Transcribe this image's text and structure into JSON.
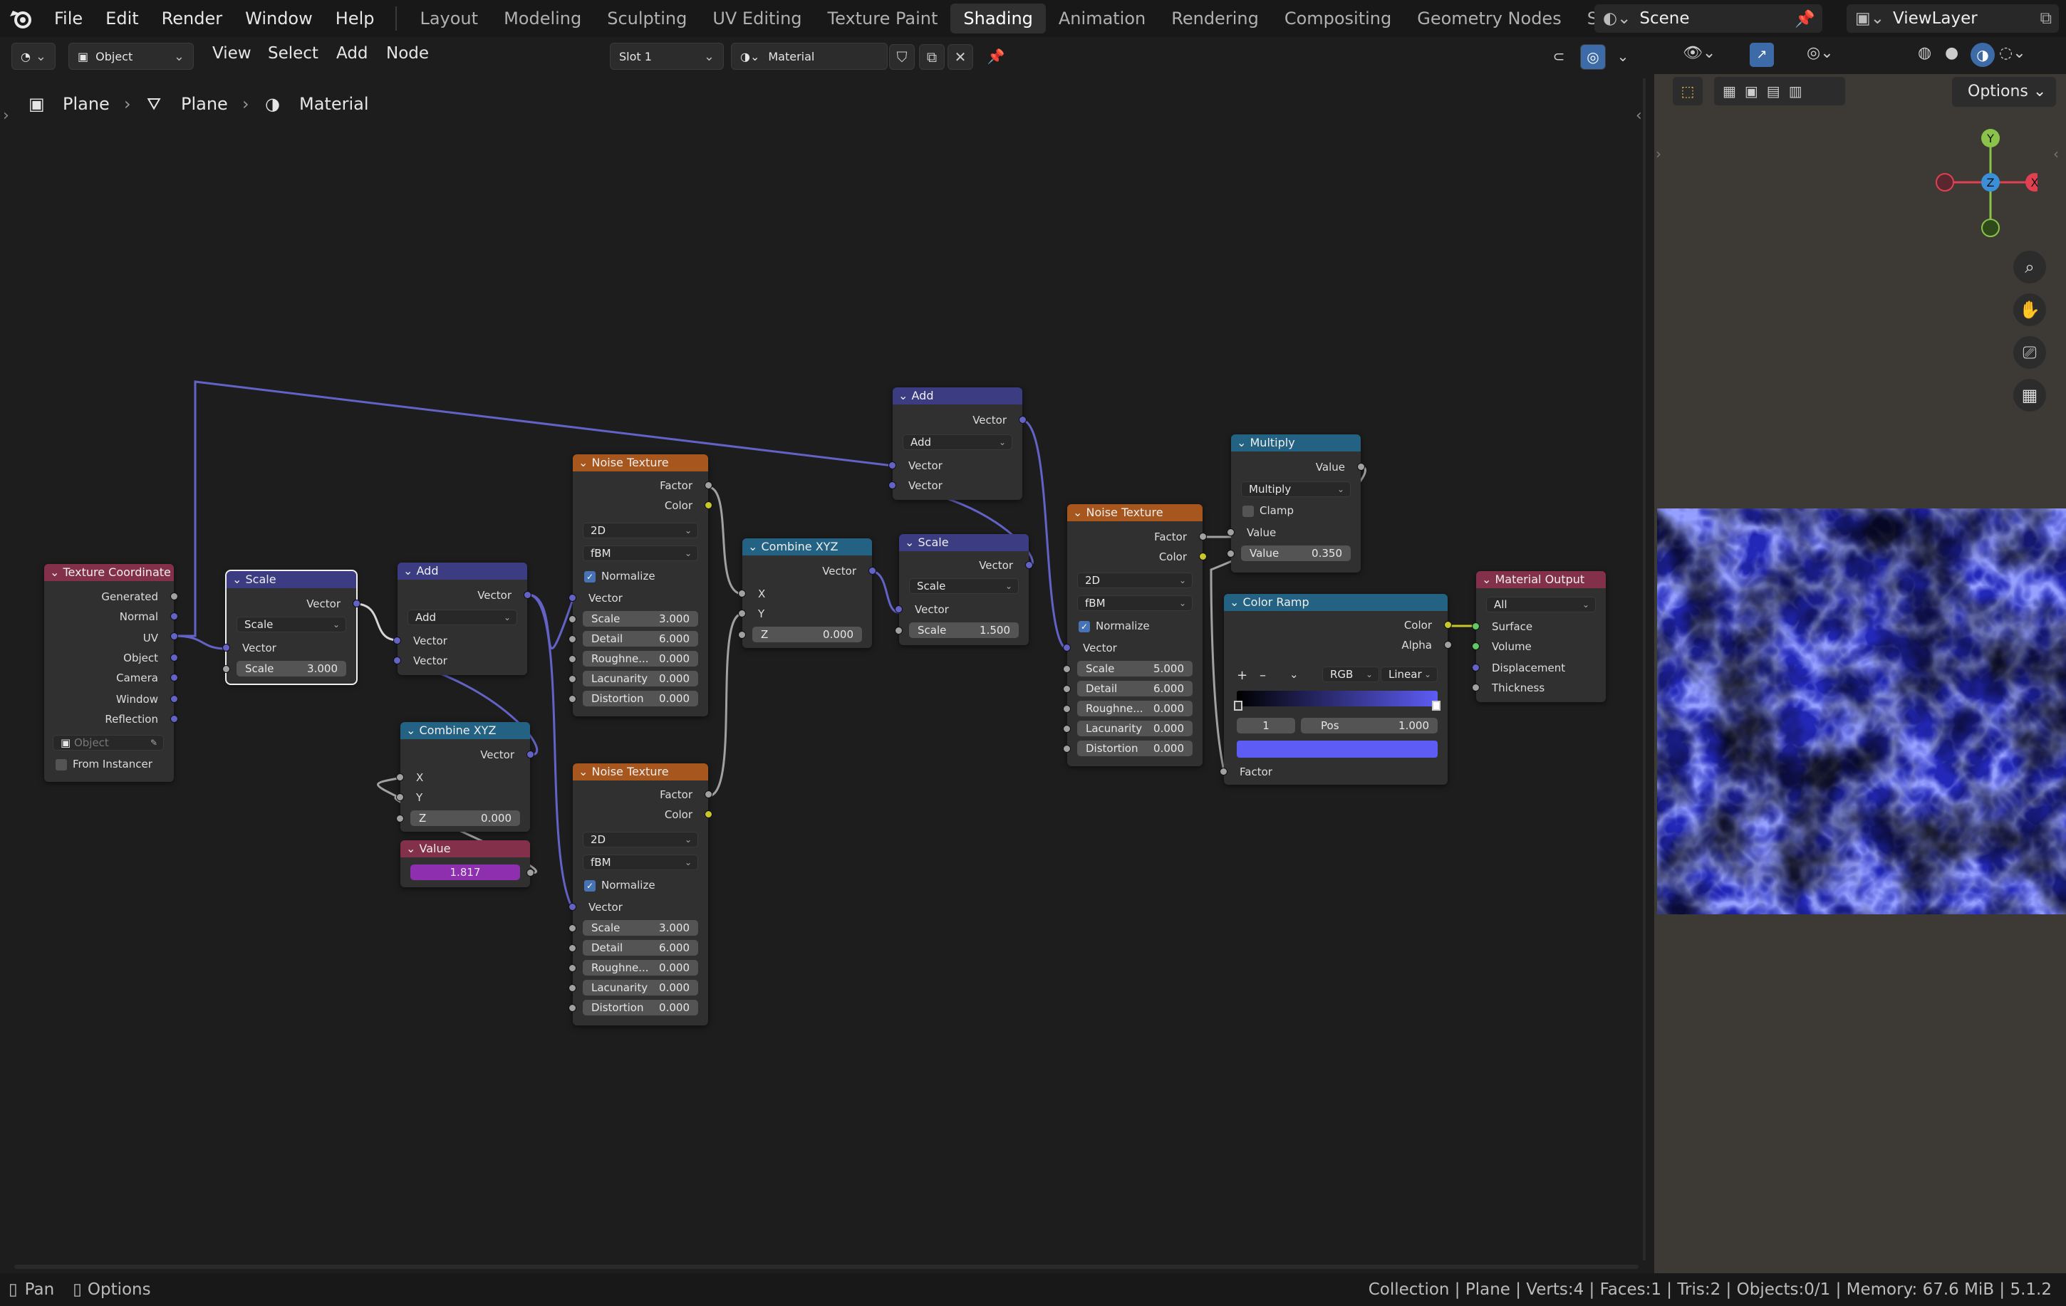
{
  "topbar": {
    "menus": [
      "File",
      "Edit",
      "Render",
      "Window",
      "Help"
    ],
    "workspaces": [
      "Layout",
      "Modeling",
      "Sculpting",
      "UV Editing",
      "Texture Paint",
      "Shading",
      "Animation",
      "Rendering",
      "Compositing",
      "Geometry Nodes",
      "Scripting"
    ],
    "active_workspace": "Shading",
    "scene": "Scene",
    "view_layer": "ViewLayer"
  },
  "editor_header": {
    "mode": "Object",
    "menus": [
      "View",
      "Select",
      "Add",
      "Node"
    ],
    "slot": "Slot 1",
    "material": "Material"
  },
  "breadcrumb": [
    "Plane",
    "Plane",
    "Material"
  ],
  "viewport": {
    "options": "Options",
    "axes": {
      "x": "X",
      "y": "Y",
      "z": "Z"
    }
  },
  "nodes": {
    "texcoord": {
      "title": "Texture Coordinate",
      "outputs": [
        "Generated",
        "Normal",
        "UV",
        "Object",
        "Camera",
        "Window",
        "Reflection"
      ],
      "object_placeholder": "Object",
      "from_instancer": "From Instancer"
    },
    "scale1": {
      "title": "Scale",
      "out": "Vector",
      "op": "Scale",
      "in": "Vector",
      "field_label": "Scale",
      "field_value": "3.000"
    },
    "add1": {
      "title": "Add",
      "out": "Vector",
      "op": "Add",
      "in1": "Vector",
      "in2": "Vector"
    },
    "combine1": {
      "title": "Combine XYZ",
      "out": "Vector",
      "x": "X",
      "y": "Y",
      "z_label": "Z",
      "z_value": "0.000"
    },
    "value": {
      "title": "Value",
      "value": "1.817"
    },
    "noise1": {
      "title": "Noise Texture",
      "out1": "Factor",
      "out2": "Color",
      "dim": "2D",
      "type": "fBM",
      "normalize": "Normalize",
      "vector": "Vector",
      "fields": [
        [
          "Scale",
          "3.000"
        ],
        [
          "Detail",
          "6.000"
        ],
        [
          "Roughne...",
          "0.000"
        ],
        [
          "Lacunarity",
          "0.000"
        ],
        [
          "Distortion",
          "0.000"
        ]
      ]
    },
    "noise2": {
      "title": "Noise Texture",
      "out1": "Factor",
      "out2": "Color",
      "dim": "2D",
      "type": "fBM",
      "normalize": "Normalize",
      "vector": "Vector",
      "fields": [
        [
          "Scale",
          "3.000"
        ],
        [
          "Detail",
          "6.000"
        ],
        [
          "Roughne...",
          "0.000"
        ],
        [
          "Lacunarity",
          "0.000"
        ],
        [
          "Distortion",
          "0.000"
        ]
      ]
    },
    "combine2": {
      "title": "Combine XYZ",
      "out": "Vector",
      "x": "X",
      "y": "Y",
      "z_label": "Z",
      "z_value": "0.000"
    },
    "add2": {
      "title": "Add",
      "out": "Vector",
      "op": "Add",
      "in1": "Vector",
      "in2": "Vector"
    },
    "scale2": {
      "title": "Scale",
      "out": "Vector",
      "op": "Scale",
      "in": "Vector",
      "field_label": "Scale",
      "field_value": "1.500"
    },
    "noise3": {
      "title": "Noise Texture",
      "out1": "Factor",
      "out2": "Color",
      "dim": "2D",
      "type": "fBM",
      "normalize": "Normalize",
      "vector": "Vector",
      "fields": [
        [
          "Scale",
          "5.000"
        ],
        [
          "Detail",
          "6.000"
        ],
        [
          "Roughne...",
          "0.000"
        ],
        [
          "Lacunarity",
          "0.000"
        ],
        [
          "Distortion",
          "0.000"
        ]
      ]
    },
    "multiply": {
      "title": "Multiply",
      "out": "Value",
      "op": "Multiply",
      "clamp": "Clamp",
      "in": "Value",
      "field_label": "Value",
      "field_value": "0.350"
    },
    "colorramp": {
      "title": "Color Ramp",
      "out1": "Color",
      "out2": "Alpha",
      "mode": "RGB",
      "interp": "Linear",
      "index": "1",
      "pos_label": "Pos",
      "pos_value": "1.000",
      "factor": "Factor"
    },
    "output": {
      "title": "Material Output",
      "target": "All",
      "inputs": [
        "Surface",
        "Volume",
        "Displacement",
        "Thickness"
      ]
    }
  },
  "statusbar": {
    "left1": "Pan",
    "left2": "Options",
    "right": "Collection | Plane | Verts:4 | Faces:1 | Tris:2 | Objects:0/1 | Memory: 67.6 MiB | 5.1.2"
  }
}
